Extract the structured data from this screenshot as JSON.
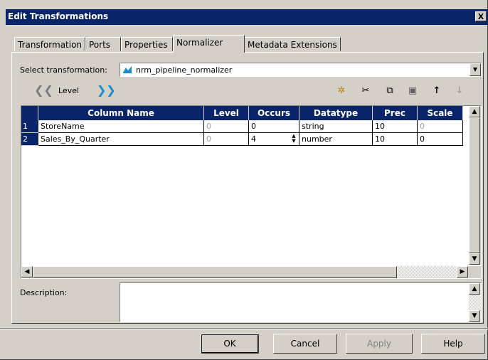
{
  "window": {
    "title": "Edit Transformations",
    "close_label": "X"
  },
  "tabs": [
    {
      "label": "Transformation"
    },
    {
      "label": "Ports"
    },
    {
      "label": "Properties"
    },
    {
      "label": "Normalizer",
      "active": true
    },
    {
      "label": "Metadata Extensions"
    }
  ],
  "select_transformation": {
    "label": "Select transformation:",
    "value": "nrm_pipeline_normalizer",
    "icon": "normalizer-icon"
  },
  "level_nav": {
    "label": "Level"
  },
  "toolbar": {
    "icons": [
      "new-icon",
      "cut-icon",
      "copy-icon",
      "paste-icon",
      "move-up-icon",
      "move-down-icon"
    ]
  },
  "grid": {
    "columns": [
      "Column Name",
      "Level",
      "Occurs",
      "Datatype",
      "Prec",
      "Scale"
    ],
    "rows": [
      {
        "num": "1",
        "name": "StoreName",
        "level": "0",
        "occurs": "0",
        "datatype": "string",
        "prec": "10",
        "scale": "0"
      },
      {
        "num": "2",
        "name": "Sales_By_Quarter",
        "level": "0",
        "occurs": "4",
        "datatype": "number",
        "prec": "10",
        "scale": "0"
      }
    ]
  },
  "description": {
    "label": "Description:",
    "value": ""
  },
  "buttons": {
    "ok": "OK",
    "cancel": "Cancel",
    "apply": "Apply",
    "help": "Help"
  },
  "colors": {
    "title_bar": "#0a246a",
    "face": "#d4d0c8",
    "header": "#0a246a"
  }
}
